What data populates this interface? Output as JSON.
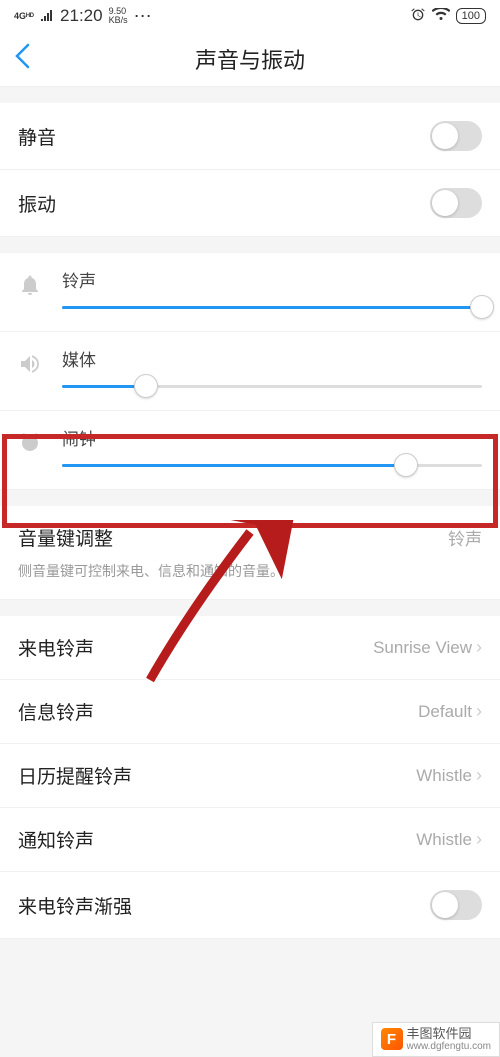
{
  "status": {
    "network": "4Gᴴᴰ",
    "time": "21:20",
    "speed_top": "9.50",
    "speed_bot": "KB/s",
    "battery": "100"
  },
  "nav": {
    "title": "声音与振动"
  },
  "toggles": {
    "mute": "静音",
    "vibrate": "振动"
  },
  "sliders": {
    "ringtone": {
      "label": "铃声",
      "percent": 100
    },
    "media": {
      "label": "媒体",
      "percent": 20
    },
    "alarm": {
      "label": "闹钟",
      "percent": 82
    }
  },
  "volumeKey": {
    "label": "音量键调整",
    "value": "铃声",
    "desc": "侧音量键可控制来电、信息和通知的音量。"
  },
  "items": [
    {
      "label": "来电铃声",
      "value": "Sunrise View"
    },
    {
      "label": "信息铃声",
      "value": "Default"
    },
    {
      "label": "日历提醒铃声",
      "value": "Whistle"
    },
    {
      "label": "通知铃声",
      "value": "Whistle"
    }
  ],
  "crescendo": {
    "label": "来电铃声渐强"
  },
  "watermark": {
    "name": "丰图软件园",
    "url": "www.dgfengtu.com"
  }
}
